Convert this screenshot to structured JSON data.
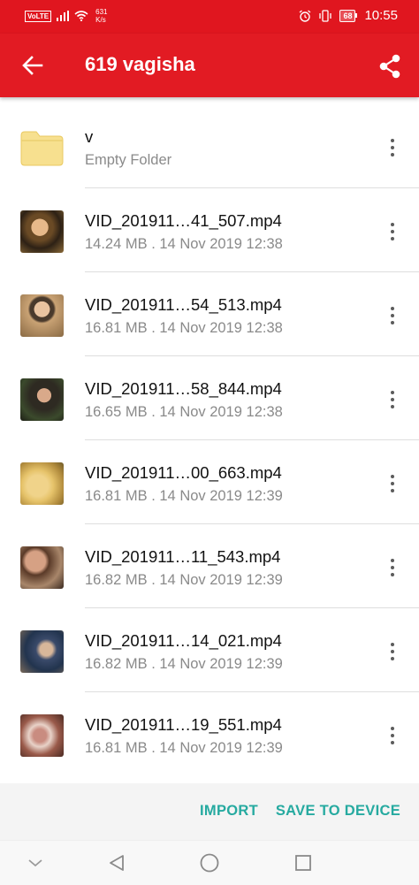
{
  "status_bar": {
    "volte": "VoLTE",
    "net_speed_value": "631",
    "net_speed_unit": "K/s",
    "battery": "68",
    "time": "10:55",
    "icons": [
      "signal-icon",
      "wifi-icon",
      "alarm-icon",
      "vibrate-icon",
      "battery-icon"
    ]
  },
  "app_bar": {
    "title": "619 vagisha",
    "back_icon": "arrow-back-icon",
    "share_icon": "share-icon"
  },
  "items": [
    {
      "type": "folder",
      "name": "v",
      "meta": "Empty Folder"
    },
    {
      "type": "video",
      "name": "VID_201911…41_507.mp4",
      "meta": "14.24 MB . 14 Nov 2019 12:38"
    },
    {
      "type": "video",
      "name": "VID_201911…54_513.mp4",
      "meta": "16.81 MB . 14 Nov 2019 12:38"
    },
    {
      "type": "video",
      "name": "VID_201911…58_844.mp4",
      "meta": "16.65 MB . 14 Nov 2019 12:38"
    },
    {
      "type": "video",
      "name": "VID_201911…00_663.mp4",
      "meta": "16.81 MB . 14 Nov 2019 12:39"
    },
    {
      "type": "video",
      "name": "VID_201911…11_543.mp4",
      "meta": "16.82 MB . 14 Nov 2019 12:39"
    },
    {
      "type": "video",
      "name": "VID_201911…14_021.mp4",
      "meta": "16.82 MB . 14 Nov 2019 12:39"
    },
    {
      "type": "video",
      "name": "VID_201911…19_551.mp4",
      "meta": "16.81 MB . 14 Nov 2019 12:39"
    }
  ],
  "actions": {
    "import_label": "IMPORT",
    "save_label": "SAVE TO DEVICE"
  },
  "colors": {
    "app_bar": "#e21b23",
    "accent": "#26aaa0",
    "folder": "#f7e08f"
  }
}
